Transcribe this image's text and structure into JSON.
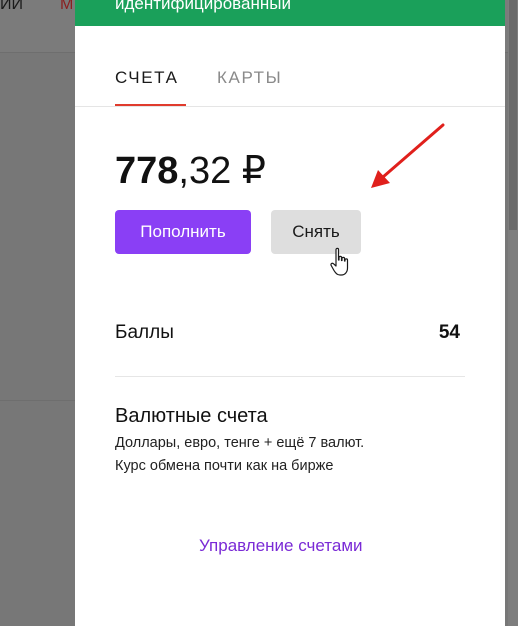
{
  "background": {
    "nav_left_text": "ИИ",
    "nav_red_text": "М"
  },
  "panel": {
    "header_text": "идентифицированный",
    "header_color": "#1aa05a",
    "tabs": [
      {
        "label": "СЧЕТА",
        "active": true
      },
      {
        "label": "КАРТЫ",
        "active": false
      }
    ],
    "balance": {
      "integer": "778",
      "fraction": ",32",
      "currency": "₽"
    },
    "buttons": {
      "topup_label": "Пополнить",
      "withdraw_label": "Снять"
    },
    "points": {
      "label": "Баллы",
      "value": "54"
    },
    "currency_accounts": {
      "title": "Валютные счета",
      "line1": "Доллары, евро, тенге + ещё 7 валют.",
      "line2": "Курс обмена почти как на бирже"
    },
    "manage_link_label": "Управление счетами"
  },
  "colors": {
    "accent_purple": "#8a3ff5",
    "link_purple": "#7a2ad6",
    "tab_underline_red": "#e03b2d",
    "annotation_arrow_red": "#e0201c"
  },
  "icons": {
    "cursor": "hand-pointer-icon",
    "annotation": "red-arrow-icon"
  }
}
